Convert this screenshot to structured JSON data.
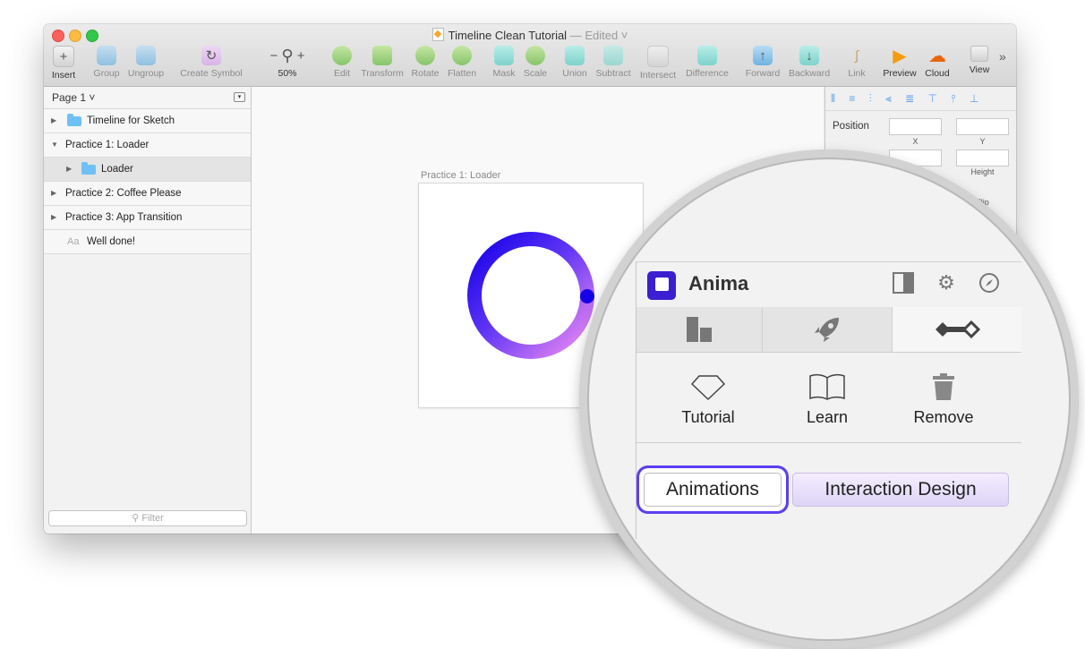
{
  "window": {
    "title": "Timeline Clean Tutorial",
    "title_status": "— Edited ˅"
  },
  "toolbar": {
    "insert": "Insert",
    "group": "Group",
    "ungroup": "Ungroup",
    "create_symbol": "Create Symbol",
    "zoom_value": "50%",
    "zoom_minus": "−",
    "zoom_plus": "+",
    "edit": "Edit",
    "transform": "Transform",
    "rotate": "Rotate",
    "flatten": "Flatten",
    "mask": "Mask",
    "scale": "Scale",
    "union": "Union",
    "subtract": "Subtract",
    "intersect": "Intersect",
    "difference": "Difference",
    "forward": "Forward",
    "backward": "Backward",
    "link": "Link",
    "preview": "Preview",
    "cloud": "Cloud",
    "view": "View",
    "overflow": "»"
  },
  "sidebar": {
    "page_selector": "Page 1 ˅",
    "layers": [
      {
        "label": "Timeline for Sketch"
      },
      {
        "label": "Practice 1: Loader"
      },
      {
        "label": "Loader"
      },
      {
        "label": "Practice 2: Coffee Please"
      },
      {
        "label": "Practice 3: App Transition"
      },
      {
        "label": "Well done!",
        "prefix": "Aa"
      }
    ],
    "filter_placeholder": "Filter"
  },
  "canvas": {
    "artboard_label": "Practice 1: Loader"
  },
  "inspector": {
    "position_label": "Position",
    "x_label": "X",
    "y_label": "Y",
    "height_label": "Height",
    "flip_label": "Flip"
  },
  "anima": {
    "title": "Anima",
    "actions": [
      {
        "label": "Tutorial",
        "icon": "diamond-icon"
      },
      {
        "label": "Learn",
        "icon": "book-icon"
      },
      {
        "label": "Remove",
        "icon": "trash-icon"
      }
    ],
    "animations_button": "Animations",
    "interaction_button": "Interaction Design"
  },
  "colors": {
    "anima_brand": "#3c1fd1",
    "highlight": "#5b3ff0",
    "loader_start": "#1500e8",
    "loader_end": "#ee8cf2"
  }
}
